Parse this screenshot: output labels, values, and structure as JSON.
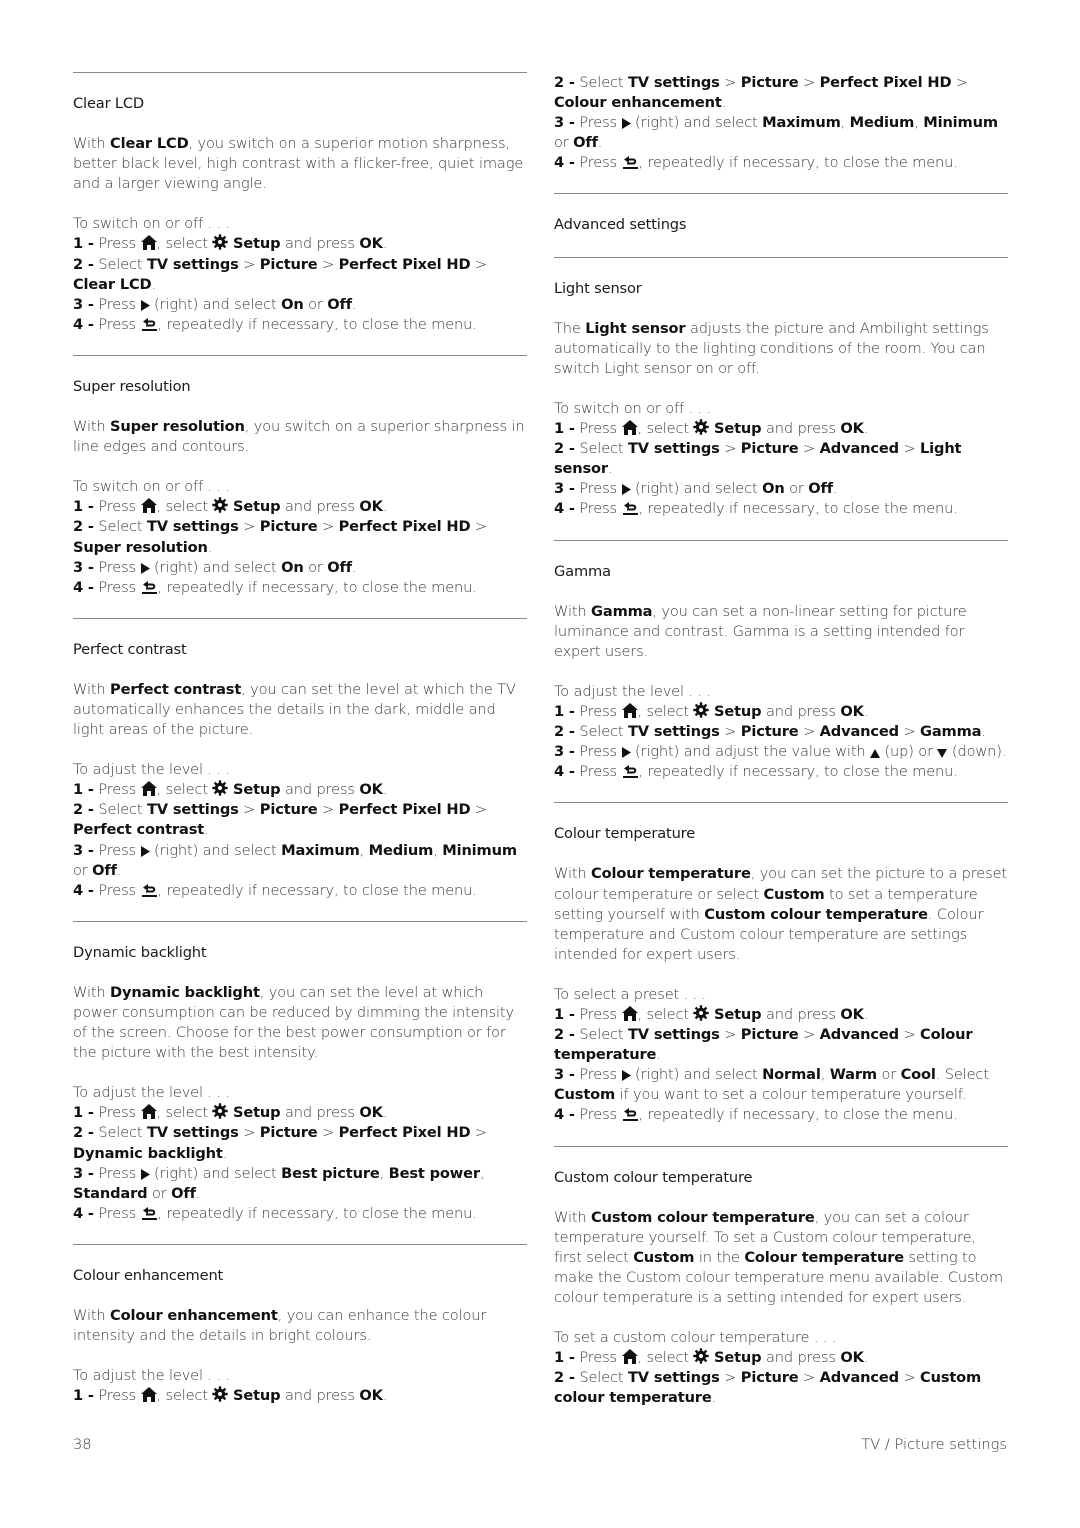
{
  "page": {
    "number": "38",
    "section_title": "TV / Picture settings"
  },
  "icons": {
    "home": "home-icon",
    "setup": "gear-icon",
    "right": "triangle-right-icon",
    "back": "back-icon",
    "up": "triangle-up-icon",
    "down": "triangle-down-icon"
  },
  "common": {
    "press": "Press",
    "select_word": ", select",
    "setup": "Setup",
    "and_press": "and press",
    "ok": "OK",
    "period": ".",
    "select_cap": "Select",
    "tv_settings": "TV settings",
    "picture": "Picture",
    "perfect_pixel_hd": "Perfect Pixel HD",
    "advanced": "Advanced",
    "gt": ">",
    "right_and_select": "(right) and select",
    "or": "or",
    "back_text": ", repeatedly if necessary, to close the menu.",
    "step1": "1 -",
    "step2": "2 -",
    "step3": "3 -",
    "step4": "4 -",
    "comma": ",",
    "on": "On",
    "off": "Off"
  },
  "sections": {
    "clear_lcd": {
      "title": "Clear LCD",
      "desc_pre": "With",
      "desc_bold": "Clear LCD",
      "desc_post": ", you switch on a superior motion sharpness, better black level, high contrast with a flicker-free, quiet image and a larger viewing angle.",
      "intro": "To switch on or off . . .",
      "target": "Clear LCD"
    },
    "super_resolution": {
      "title": "Super resolution",
      "desc_pre": "With",
      "desc_bold": "Super resolution",
      "desc_post": ", you switch on a superior sharpness in line edges and contours.",
      "intro": "To switch on or off . . .",
      "target": "Super resolution"
    },
    "perfect_contrast": {
      "title": "Perfect contrast",
      "desc_pre": "With",
      "desc_bold": "Perfect contrast",
      "desc_post": ", you can set the level at which the TV automatically enhances the details in the dark, middle and light areas of the picture.",
      "intro": "To adjust the level . . .",
      "target": "Perfect contrast",
      "options": [
        "Maximum",
        "Medium",
        "Minimum",
        "Off"
      ]
    },
    "dynamic_backlight": {
      "title": "Dynamic backlight",
      "desc_pre": "With",
      "desc_bold": "Dynamic backlight",
      "desc_post": ", you can set the level at which power consumption can be reduced by dimming the intensity of the screen. Choose for the best power consumption or for the picture with the best intensity.",
      "intro": "To adjust the level . . .",
      "target": "Dynamic backlight",
      "options": [
        "Best picture",
        "Best power",
        "Standard",
        "Off"
      ]
    },
    "colour_enhancement": {
      "title": "Colour enhancement",
      "desc_pre": "With",
      "desc_bold": "Colour enhancement",
      "desc_post": ", you can enhance the colour intensity and the details in bright colours.",
      "intro": "To adjust the level . . .",
      "target": "Colour enhancement",
      "options": [
        "Maximum",
        "Medium",
        "Minimum",
        "Off"
      ]
    },
    "advanced_settings": {
      "title": "Advanced settings"
    },
    "light_sensor": {
      "title": "Light sensor",
      "desc_pre": "The",
      "desc_bold": "Light sensor",
      "desc_post": " adjusts the picture and Ambilight settings automatically to the lighting conditions of the room. You can switch Light sensor on or off.",
      "intro": "To switch on or off . . .",
      "target": "Light sensor"
    },
    "gamma": {
      "title": "Gamma",
      "desc_pre": "With",
      "desc_bold": "Gamma",
      "desc_post": ", you can set a non-linear setting for picture luminance and contrast. Gamma is a setting intended for expert users.",
      "intro": "To adjust the level . . .",
      "target": "Gamma",
      "step3_pre": "(right) and adjust the value with",
      "step3_up": "(up) or",
      "step3_down": "(down)."
    },
    "colour_temperature": {
      "title": "Colour temperature",
      "desc_pre": "With",
      "desc_bold": "Colour temperature",
      "desc_mid1": ", you can set the picture to a preset colour temperature or select",
      "desc_bold2": "Custom",
      "desc_mid2": "to set a temperature setting yourself with",
      "desc_bold3": "Custom colour temperature",
      "desc_post": ". Colour temperature and Custom colour temperature are settings intended for expert users.",
      "intro": "To select a preset . . .",
      "target": "Colour temperature",
      "options": [
        "Normal",
        "Warm",
        "Cool"
      ],
      "step3_select": ". Select",
      "step3_custom": "Custom",
      "step3_post": "if you want to set a colour temperature yourself."
    },
    "custom_colour_temperature": {
      "title": "Custom colour temperature",
      "desc_pre": "With",
      "desc_bold": "Custom colour temperature",
      "desc_mid1": ", you can set a colour temperature yourself. To set a Custom colour temperature, first select",
      "desc_bold2": "Custom",
      "desc_mid2": "in the",
      "desc_bold3": "Colour temperature",
      "desc_post": "setting to make the Custom colour temperature menu available. Custom colour temperature is a setting intended for expert users.",
      "intro": "To set a custom colour temperature . . .",
      "target": "Custom colour temperature"
    }
  }
}
